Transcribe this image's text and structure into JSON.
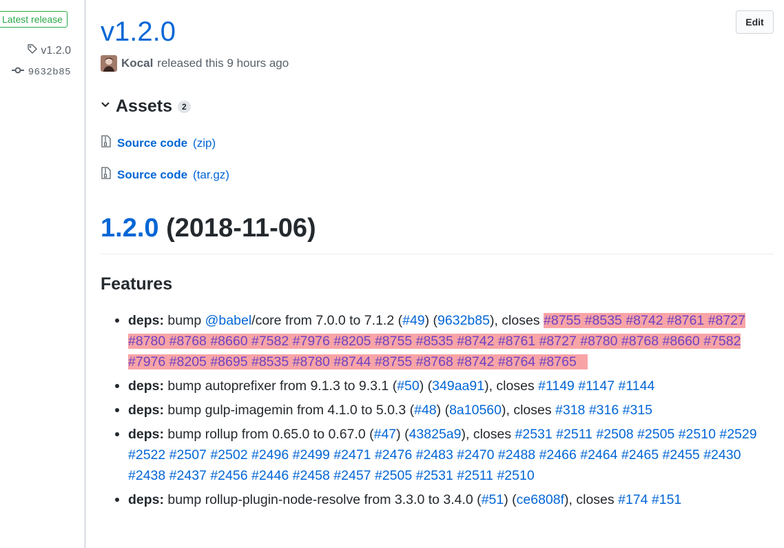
{
  "sidebar": {
    "latest_label": "Latest release",
    "tag": "v1.2.0",
    "commit": "9632b85"
  },
  "release": {
    "title": "v1.2.0",
    "edit_label": "Edit",
    "author": "Kocal",
    "released_text": "released this 9 hours ago"
  },
  "assets": {
    "title": "Assets",
    "count": "2",
    "items": [
      {
        "label": "Source code",
        "ext": "(zip)"
      },
      {
        "label": "Source code",
        "ext": "(tar.gz)"
      }
    ]
  },
  "notes": {
    "version_link": "1.2.0",
    "version_date": "(2018-11-06)",
    "features_heading": "Features",
    "items": [
      {
        "prefix": "deps:",
        "text_before": " bump ",
        "mention": "@babel",
        "text_mid": "/core from 7.0.0 to 7.1.2 (",
        "pr": "#49",
        "sep": ") (",
        "commit": "9632b85",
        "closes": "), closes ",
        "refs_plain": [],
        "refs_highlight": [
          "#8755",
          "#8535",
          "#8742",
          "#8761",
          "#8727",
          "#8780",
          "#8768",
          "#8660",
          "#7582",
          "#7976",
          "#8205",
          "#8755",
          "#8535",
          "#8742",
          "#8761",
          "#8727",
          "#8780",
          "#8768",
          "#8660",
          "#7582",
          "#7976",
          "#8205",
          "#8695",
          "#8535",
          "#8780",
          "#8744",
          "#8755",
          "#8768",
          "#8742",
          "#8764",
          "#8765"
        ]
      },
      {
        "prefix": "deps:",
        "text_before": " bump autoprefixer from 9.1.3 to 9.3.1 (",
        "pr": "#50",
        "sep": ") (",
        "commit": "349aa91",
        "closes": "), closes ",
        "refs_plain": [
          "#1149",
          "#1147",
          "#1144"
        ]
      },
      {
        "prefix": "deps:",
        "text_before": " bump gulp-imagemin from 4.1.0 to 5.0.3 (",
        "pr": "#48",
        "sep": ") (",
        "commit": "8a10560",
        "closes": "), closes ",
        "refs_plain": [
          "#318",
          "#316",
          "#315"
        ]
      },
      {
        "prefix": "deps:",
        "text_before": " bump rollup from 0.65.0 to 0.67.0 (",
        "pr": "#47",
        "sep": ") (",
        "commit": "43825a9",
        "closes": "), closes ",
        "refs_plain": [
          "#2531",
          "#2511",
          "#2508",
          "#2505",
          "#2510",
          "#2529",
          "#2522",
          "#2507",
          "#2502",
          "#2496",
          "#2499",
          "#2471",
          "#2476",
          "#2483",
          "#2470",
          "#2488",
          "#2466",
          "#2464",
          "#2465",
          "#2455",
          "#2430",
          "#2438",
          "#2437",
          "#2456",
          "#2446",
          "#2458",
          "#2457",
          "#2505",
          "#2531",
          "#2511",
          "#2510"
        ]
      },
      {
        "prefix": "deps:",
        "text_before": " bump rollup-plugin-node-resolve from 3.3.0 to 3.4.0 (",
        "pr": "#51",
        "sep": ") (",
        "commit": "ce6808f",
        "closes": "), closes ",
        "refs_plain": [
          "#174",
          "#151"
        ]
      }
    ]
  }
}
